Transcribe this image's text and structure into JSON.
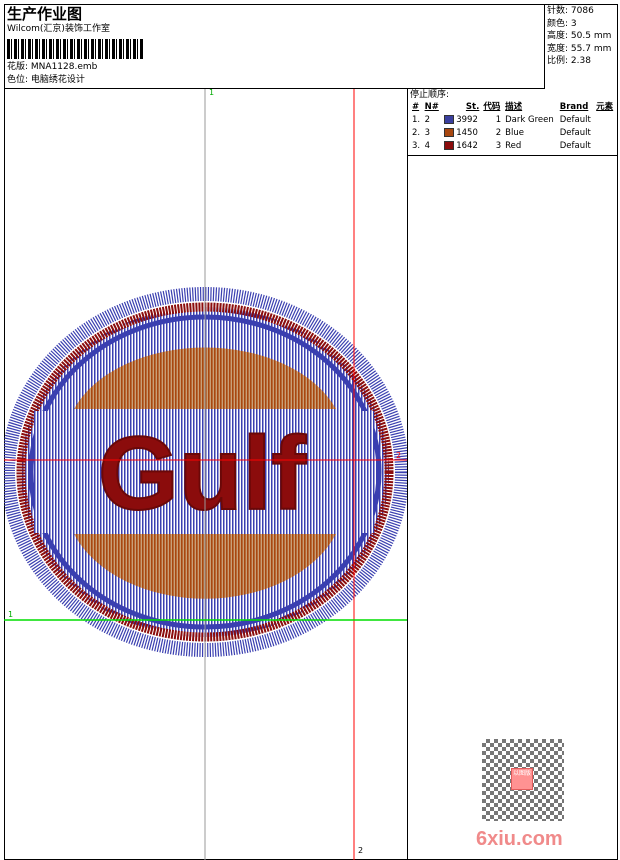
{
  "header": {
    "title": "生产作业图",
    "company": "Wilcom(汇京)装饰工作室",
    "design_label": "花版:",
    "design_file": "MNA1128.emb",
    "color_label": "色位:",
    "color_value": "电脑绣花设计"
  },
  "stats": [
    {
      "label": "针数:",
      "value": "7086"
    },
    {
      "label": "颜色:",
      "value": "3"
    },
    {
      "label": "高度:",
      "value": "50.5 mm"
    },
    {
      "label": "宽度:",
      "value": "55.7 mm"
    },
    {
      "label": "比例:",
      "value": "2.38"
    }
  ],
  "stop_sequence": {
    "title": "停止顺序:",
    "columns": [
      "#",
      "N#",
      "St.",
      "代码",
      "描述",
      "Brand",
      "元素"
    ],
    "rows": [
      {
        "idx": "1.",
        "n": "2",
        "color": "#3a3f9e",
        "st": "3992",
        "code": "1",
        "desc": "Dark Green",
        "brand": "Default"
      },
      {
        "idx": "2.",
        "n": "3",
        "color": "#a8470f",
        "st": "1450",
        "code": "2",
        "desc": "Blue",
        "brand": "Default"
      },
      {
        "idx": "3.",
        "n": "4",
        "color": "#8b0c0c",
        "st": "1642",
        "code": "3",
        "desc": "Red",
        "brand": "Default"
      }
    ]
  },
  "design": {
    "text": "Gulf",
    "colors": {
      "blue": "#3a3fb0",
      "orange": "#a8470f",
      "red": "#8b0c0c"
    },
    "guides": {
      "top": "1",
      "right": "2",
      "left": "1",
      "bottom": "2"
    }
  },
  "watermark": {
    "stamp": "以图版",
    "site": "6xiu.com"
  }
}
